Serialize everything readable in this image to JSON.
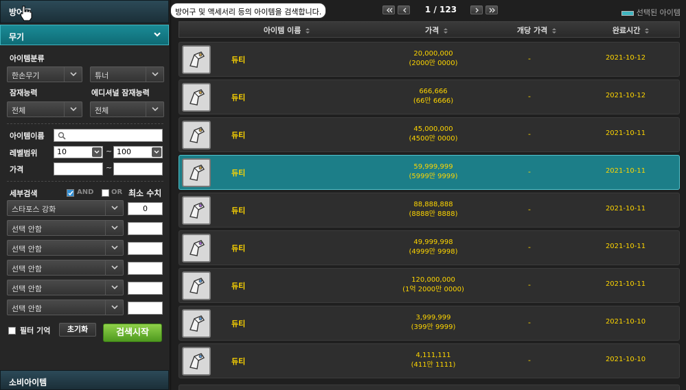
{
  "left": {
    "tab_armor": "방어구",
    "tab_weapon": "무기",
    "tab_consume": "소비아이템",
    "item_category_label": "아이템분류",
    "category_main": "한손무기",
    "category_sub": "튜너",
    "potential_label": "잠재능력",
    "additional_potential_label": "에디셔널 잠재능력",
    "potential_value": "전체",
    "additional_potential_value": "전체",
    "item_name_label": "아이템이름",
    "item_name_value": "",
    "level_label": "레벨범위",
    "level_min": "10",
    "level_max": "100",
    "level_sep": "~",
    "price_label": "가격",
    "price_sep": "~",
    "price_min": "",
    "price_max": "",
    "detail_search_label": "세부검색",
    "and_label": "AND",
    "or_label": "OR",
    "min_value_label": "최소 수치",
    "detail_rows": [
      {
        "option": "스타포스 강화",
        "value": "0"
      },
      {
        "option": "선택 안함",
        "value": ""
      },
      {
        "option": "선택 안함",
        "value": ""
      },
      {
        "option": "선택 안함",
        "value": ""
      },
      {
        "option": "선택 안함",
        "value": ""
      },
      {
        "option": "선택 안함",
        "value": ""
      }
    ],
    "filter_memory_label": "필터 기억",
    "reset_label": "초기화",
    "search_label": "검색시작"
  },
  "right": {
    "tooltip": "방어구 및 액세서리 등의 아이템을 검색합니다.",
    "page_text": "1 / 123",
    "legend_text": "선택된 아이템",
    "headers": {
      "name": "아이템 이름",
      "price": "가격",
      "unit_price": "개당 가격",
      "end_time": "완료시간"
    },
    "rows": [
      {
        "name": "듀티",
        "price": "20,000,000",
        "price_kr": "(2000만 0000)",
        "unit": "-",
        "date": "2021-10-12"
      },
      {
        "name": "듀티",
        "price": "666,666",
        "price_kr": "(66만 6666)",
        "unit": "-",
        "date": "2021-10-12"
      },
      {
        "name": "듀티",
        "price": "45,000,000",
        "price_kr": "(4500만 0000)",
        "unit": "-",
        "date": "2021-10-11"
      },
      {
        "name": "듀티",
        "price": "59,999,999",
        "price_kr": "(5999만 9999)",
        "unit": "-",
        "date": "2021-10-11"
      },
      {
        "name": "듀티",
        "price": "88,888,888",
        "price_kr": "(8888만 8888)",
        "unit": "-",
        "date": "2021-10-11"
      },
      {
        "name": "듀티",
        "price": "49,999,998",
        "price_kr": "(4999만 9998)",
        "unit": "-",
        "date": "2021-10-11"
      },
      {
        "name": "듀티",
        "price": "120,000,000",
        "price_kr": "(1억 2000만 0000)",
        "unit": "-",
        "date": "2021-10-11"
      },
      {
        "name": "듀티",
        "price": "3,999,999",
        "price_kr": "(399만 9999)",
        "unit": "-",
        "date": "2021-10-10"
      },
      {
        "name": "듀티",
        "price": "4,111,111",
        "price_kr": "(411만 1111)",
        "unit": "-",
        "date": "2021-10-10"
      }
    ]
  }
}
